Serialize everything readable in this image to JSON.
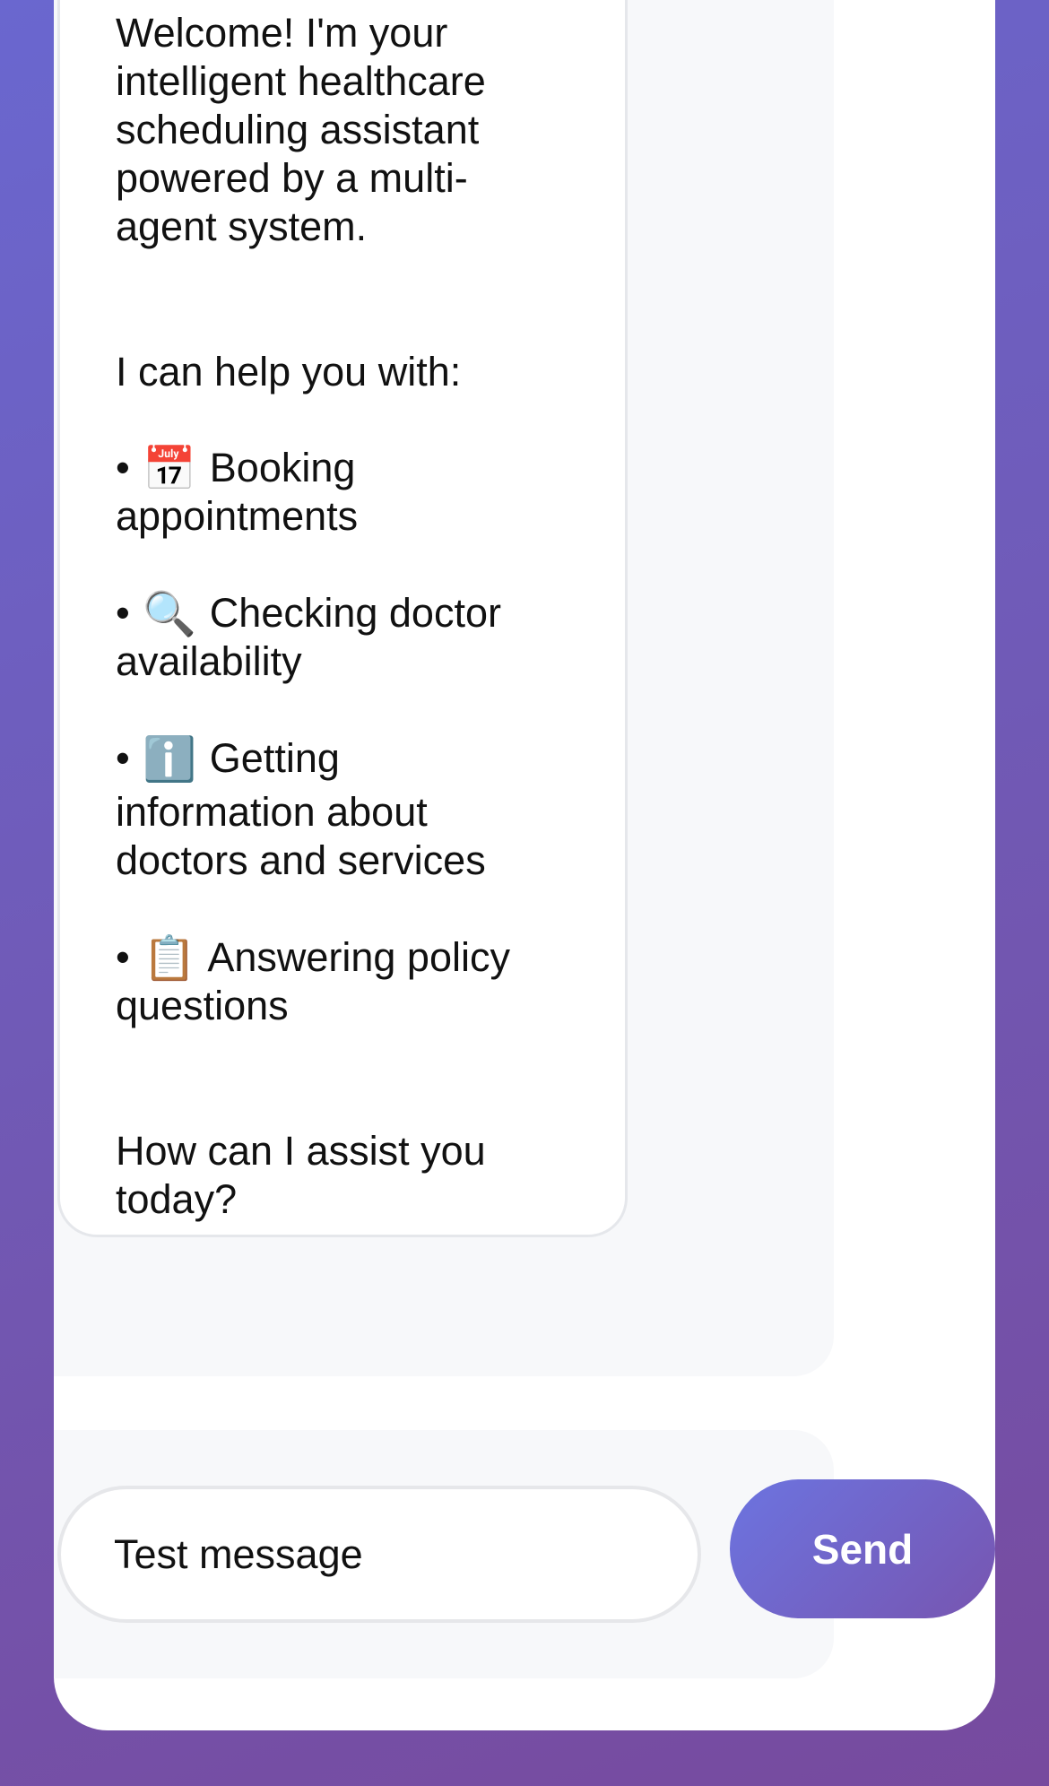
{
  "chat": {
    "assistant_message": {
      "intro_lines": [
        "Welcome! I'm your",
        "intelligent healthcare",
        "scheduling assistant",
        "powered by a multi-",
        "agent system."
      ],
      "help_heading": "I can help you with:",
      "bullet": "•",
      "items": [
        {
          "icon": "calendar-icon",
          "glyph": "📅",
          "line1": "Booking",
          "line2": "appointments"
        },
        {
          "icon": "magnifier-icon",
          "glyph": "🔍",
          "line1": "Checking doctor",
          "line2": "availability"
        },
        {
          "icon": "info-icon",
          "glyph": "ℹ️",
          "line1": "Getting",
          "line2": "information about",
          "line3": "doctors and services"
        },
        {
          "icon": "clipboard-icon",
          "glyph": "📋",
          "line1": "Answering policy",
          "line2": "questions"
        }
      ],
      "closing_lines": [
        "How can I assist you",
        "today?"
      ]
    }
  },
  "composer": {
    "input_value": "Test message",
    "send_label": "Send"
  },
  "colors": {
    "background_start": "#6a67cf",
    "background_end": "#774a9e",
    "send_button_start": "#6c74e0",
    "send_button_end": "#7755b0",
    "chat_area": "#f7f8fa",
    "bubble_border": "#e5e7eb"
  }
}
